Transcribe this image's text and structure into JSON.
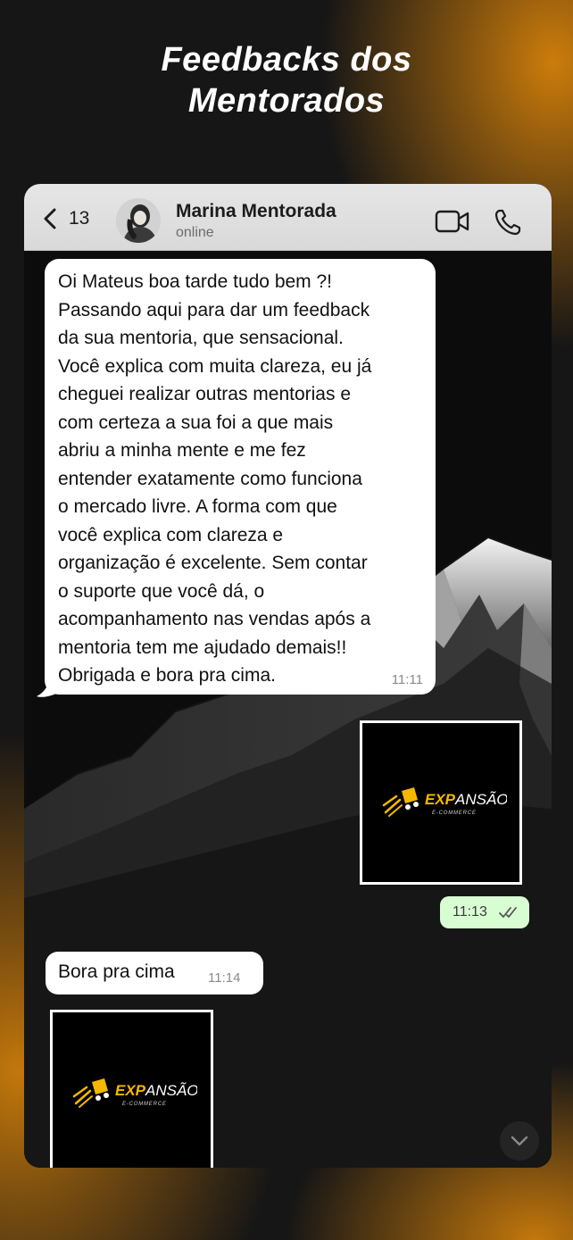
{
  "headline": {
    "line1": "Feedbacks dos",
    "line2": "Mentorados"
  },
  "chat": {
    "unread_count": "13",
    "contact_name": "Marina Mentorada",
    "status": "online",
    "icons": {
      "back": "chevron-left-icon",
      "video": "video-camera-icon",
      "call": "phone-icon",
      "scroll": "chevron-down-icon"
    },
    "messages": [
      {
        "direction": "incoming",
        "text": "Oi Mateus boa tarde tudo bem ?!\nPassando aqui para dar um feedback\nda sua mentoria, que sensacional.\nVocê explica com muita clareza, eu já\ncheguei realizar outras mentorias e\ncom certeza a sua foi a que mais\nabriu a minha mente e me fez\nentender exatamente como funciona\no mercado livre. A forma com que\nvocê explica com clareza e\norganização é excelente. Sem contar\no suporte que você dá, o\nacompanhamento nas vendas após a\nmentoria tem me ajudado demais!!\nObrigada e bora pra cima.",
        "time": "11:11"
      },
      {
        "direction": "outgoing",
        "type": "image",
        "time": "11:13",
        "status": "read"
      },
      {
        "direction": "incoming",
        "text": "Bora pra cima",
        "time": "11:14"
      },
      {
        "direction": "incoming",
        "type": "image"
      }
    ]
  },
  "logo": {
    "brand_bold": "EXP",
    "brand_rest": "ANSÃO",
    "tagline": "E-COMMERCE",
    "accent_color": "#f5b800"
  },
  "colors": {
    "accent_glow": "#d6820a",
    "outgoing_bubble": "#d9fdd3",
    "incoming_bubble": "#ffffff",
    "read_ticks": "#53bdeb"
  }
}
